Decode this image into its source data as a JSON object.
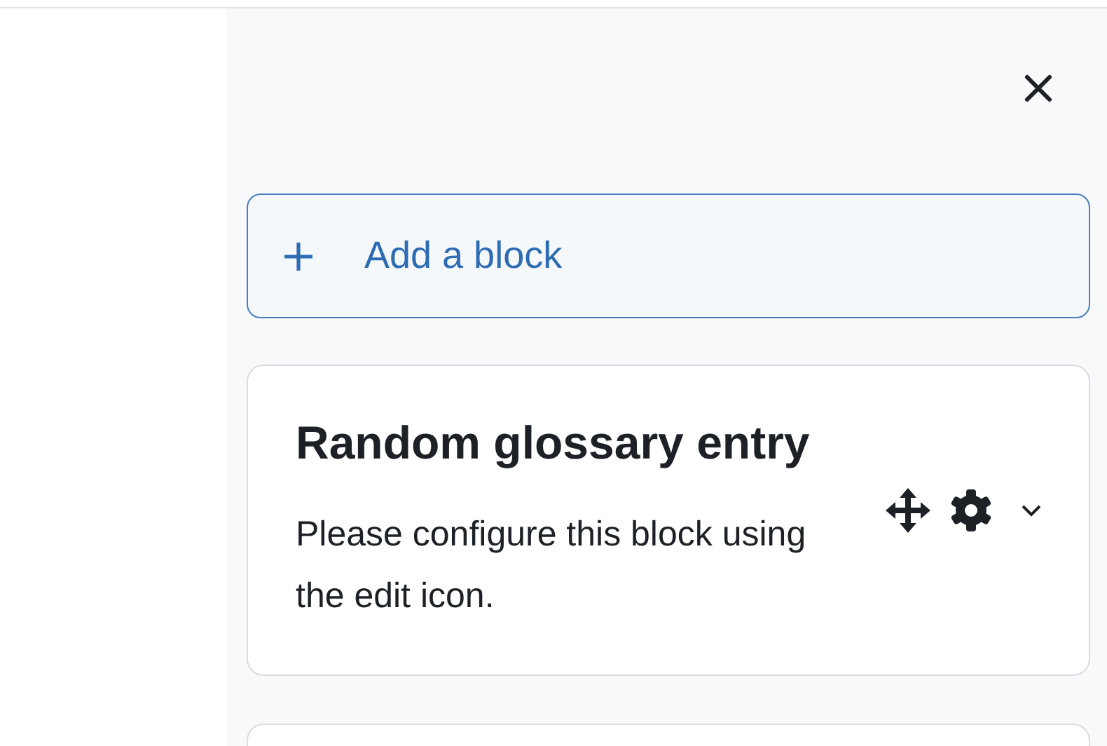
{
  "add_block": {
    "label": "Add a block"
  },
  "blocks": [
    {
      "kind": "text",
      "title": "Random glossary entry",
      "body": "Please configure this block using the edit icon."
    },
    {
      "kind": "cut"
    }
  ]
}
